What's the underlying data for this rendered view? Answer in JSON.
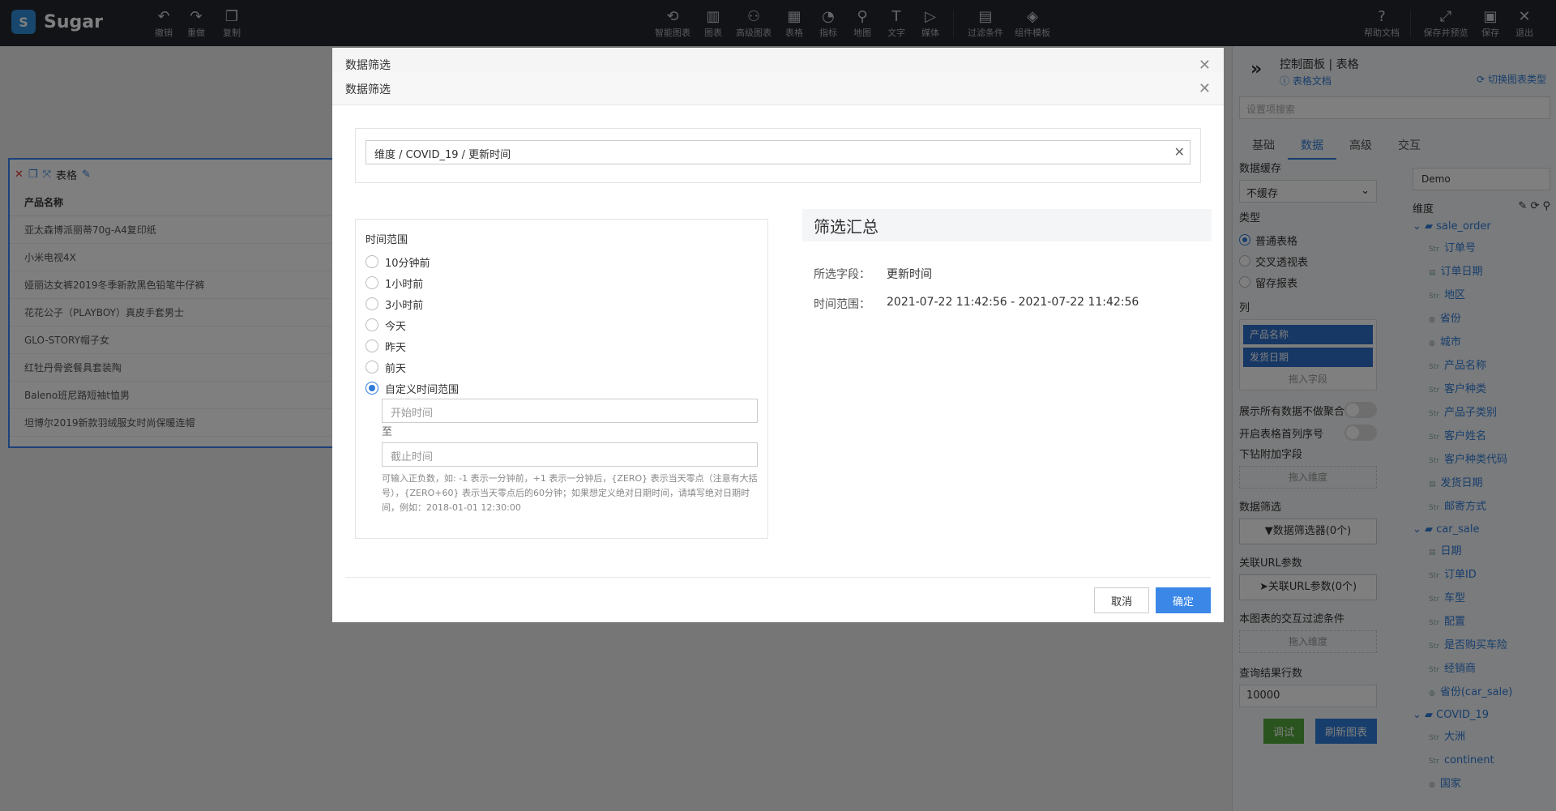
{
  "app": {
    "name": "Sugar",
    "logo_glyph": "S"
  },
  "toolbar": {
    "undo": "撤销",
    "redo": "重做",
    "copy": "复制",
    "smart_chart": "智能图表",
    "chart": "图表",
    "advanced_chart": "高级图表",
    "table": "表格",
    "metric": "指标",
    "map": "地图",
    "text": "文字",
    "media": "媒体",
    "filter": "过滤条件",
    "component_template": "组件模板",
    "help": "帮助文档",
    "save_preview": "保存并预览",
    "save": "保存",
    "exit": "退出"
  },
  "widget": {
    "title": "表格",
    "column": "产品名称",
    "rows": [
      "亚太森博派丽蒂70g-A4复印纸",
      "小米电视4X",
      "娅丽达女裤2019冬季新款黑色铅笔牛仔裤",
      "花花公子（PLAYBOY）真皮手套男士",
      "GLO-STORY帽子女",
      "红牡丹骨瓷餐具套装陶",
      "Baleno班尼路短袖t恤男",
      "坦博尔2019新款羽绒服女时尚保暖连帽"
    ]
  },
  "right_panel": {
    "title": "控制面板 | 表格",
    "doc_link": "表格文档",
    "switch_type": "切换图表类型",
    "search_placeholder": "设置项搜索",
    "tabs": [
      "基础",
      "数据",
      "高级",
      "交互"
    ],
    "cache_label": "数据缓存",
    "cache_value": "不缓存",
    "type_label": "类型",
    "types": [
      "普通表格",
      "交叉透视表",
      "留存报表"
    ],
    "columns_label": "列",
    "columns": [
      "产品名称",
      "发货日期"
    ],
    "drag_field": "拖入字段",
    "show_all": "展示所有数据不做聚合",
    "row_index": "开启表格首列序号",
    "drill_label": "下钻附加字段",
    "drag_dimension": "拖入维度",
    "data_filter_label": "数据筛选",
    "data_filter_btn": "数据筛选器(0个)",
    "url_param_label": "关联URL参数",
    "url_param_btn": "关联URL参数(0个)",
    "interaction_label": "本图表的交互过滤条件",
    "drag_dimension2": "拖入维度",
    "rows_label": "查询结果行数",
    "rows_value": "10000",
    "debug": "调试",
    "refresh": "刷新图表",
    "datasource": "Demo",
    "dim_label": "维度",
    "tree": [
      {
        "group": "sale_order",
        "items": [
          {
            "type": "Str",
            "name": "订单号"
          },
          {
            "type": "date",
            "name": "订单日期"
          },
          {
            "type": "Str",
            "name": "地区"
          },
          {
            "type": "geo",
            "name": "省份"
          },
          {
            "type": "geo",
            "name": "城市"
          },
          {
            "type": "Str",
            "name": "产品名称"
          },
          {
            "type": "Str",
            "name": "客户种类"
          },
          {
            "type": "Str",
            "name": "产品子类别"
          },
          {
            "type": "Str",
            "name": "客户姓名"
          },
          {
            "type": "Str",
            "name": "客户种类代码"
          },
          {
            "type": "date",
            "name": "发货日期"
          },
          {
            "type": "Str",
            "name": "邮寄方式"
          }
        ]
      },
      {
        "group": "car_sale",
        "items": [
          {
            "type": "date",
            "name": "日期"
          },
          {
            "type": "Str",
            "name": "订单ID"
          },
          {
            "type": "Str",
            "name": "车型"
          },
          {
            "type": "Str",
            "name": "配置"
          },
          {
            "type": "Str",
            "name": "是否购买车险"
          },
          {
            "type": "Str",
            "name": "经销商"
          },
          {
            "type": "geo",
            "name": "省份(car_sale)"
          }
        ]
      },
      {
        "group": "COVID_19",
        "items": [
          {
            "type": "Str",
            "name": "大洲"
          },
          {
            "type": "Str",
            "name": "continent"
          },
          {
            "type": "geo",
            "name": "国家"
          }
        ]
      }
    ]
  },
  "modal_back": {
    "title": "数据筛选"
  },
  "modal": {
    "title": "数据筛选",
    "path": "维度 / COVID_19 / 更新时间",
    "time_range_label": "时间范围",
    "options": [
      "10分钟前",
      "1小时前",
      "3小时前",
      "今天",
      "昨天",
      "前天",
      "自定义时间范围"
    ],
    "selected_option": 6,
    "start_placeholder": "开始时间",
    "to": "至",
    "end_placeholder": "截止时间",
    "hint": "可输入正负数，如: -1 表示一分钟前，+1 表示一分钟后，{ZERO} 表示当天零点（注意有大括号），{ZERO+60} 表示当天零点后的60分钟；如果想定义绝对日期时间，请填写绝对日期时间，例如：2018-01-01 12:30:00",
    "summary_title": "筛选汇总",
    "field_key": "所选字段：",
    "field_val": "更新时间",
    "range_key": "时间范围：",
    "range_val": "2021-07-22 11:42:56 - 2021-07-22 11:42:56",
    "cancel": "取消",
    "ok": "确定"
  }
}
